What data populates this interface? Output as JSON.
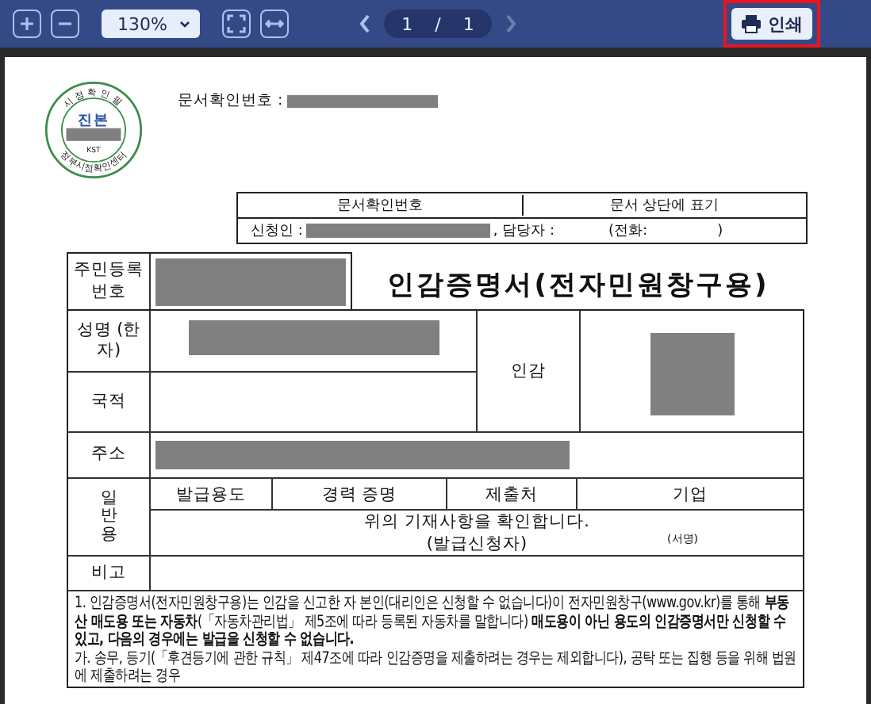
{
  "toolbar": {
    "zoom": "130%",
    "page": {
      "current": "1",
      "separator": "/",
      "total": "1"
    },
    "prev_disabled": false,
    "next_disabled": true,
    "print_label": "인쇄",
    "print_highlighted": true
  },
  "document": {
    "verification_label": "문서확인번호 :",
    "stamp": {
      "top_text": "시점확인필",
      "center_text": "진본",
      "code": "KST",
      "bottom_text": "정부시점확인센터"
    },
    "request_table": {
      "header": [
        "문서확인번호",
        "문서 상단에 표기"
      ],
      "applicant_label": "신청인 :",
      "staff_label": ", 담당자 :",
      "phone_label": "(전화:",
      "phone_close": ")"
    },
    "title": "인감증명서(전자민원창구용)",
    "form": {
      "id_label": "주민등록 번호",
      "name_label": "성명 (한자)",
      "nationality_label": "국적",
      "seal_label": "인감",
      "address_label": "주소",
      "general_label": "일반용",
      "purpose_label": "발급용도",
      "purpose_value": "경력 증명",
      "recipient_label": "제출처",
      "recipient_value": "기업",
      "confirm_text": "위의 기재사항을 확인합니다.",
      "applicant_text": "(발급신청자)",
      "signature_text": "(서명)",
      "remarks_label": "비고"
    },
    "notes": [
      "1. 인감증명서(전자민원창구용)는 인감을 신고한 자 본인(대리인은 신청할 수 없습니다)이 전자민원창구(www.gov.kr)를 통해 **부동산 매도용 또는 자동차**(「자동차관리법」 제5조에 따라 등록된 자동차를 말합니다) **매도용이 아닌 용도의 인감증명서만 신청할 수 있고, 다음의 경우에는 발급을 신청할 수 없습니다.**",
      "가. 송무, 등기(「후견등기에 관한 규칙」 제47조에 따라 인감증명을 제출하려는 경우는 제외합니다), 공탁 또는 집행 등을 위해 법원에 제출하려는 경우"
    ]
  }
}
